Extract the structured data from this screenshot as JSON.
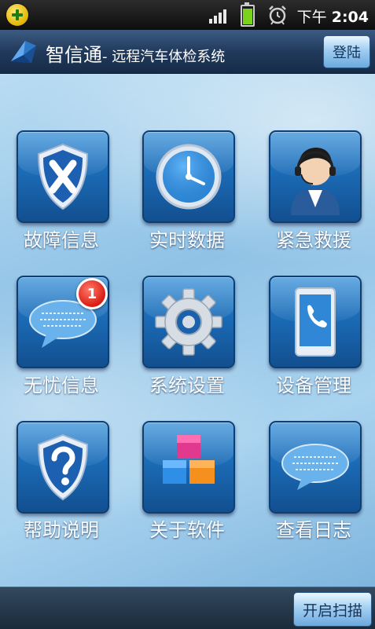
{
  "status_bar": {
    "time_period": "下午",
    "time": "2:04",
    "battery_level": 0.85,
    "signal_bars": 4
  },
  "header": {
    "title": "智信通",
    "subtitle": "- 远程汽车体检系统",
    "login_label": "登陆"
  },
  "menu": [
    {
      "label": "故障信息",
      "icon": "shield-x-icon"
    },
    {
      "label": "实时数据",
      "icon": "clock-icon"
    },
    {
      "label": "紧急救援",
      "icon": "operator-icon"
    },
    {
      "label": "无忧信息",
      "icon": "message-bubble-icon",
      "badge": "1"
    },
    {
      "label": "系统设置",
      "icon": "gear-icon"
    },
    {
      "label": "设备管理",
      "icon": "phone-device-icon"
    },
    {
      "label": "帮助说明",
      "icon": "shield-question-icon"
    },
    {
      "label": "关于软件",
      "icon": "blocks-icon"
    },
    {
      "label": "查看日志",
      "icon": "speech-bubble-icon"
    }
  ],
  "footer": {
    "scan_label": "开启扫描"
  },
  "colors": {
    "tile": "#1b6bb6",
    "badge": "#d91d12",
    "title_bar": "#213a5c"
  }
}
